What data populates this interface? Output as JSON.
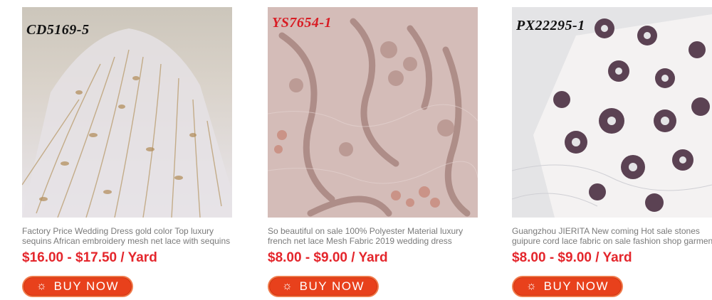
{
  "products": [
    {
      "code": "CD5169-5",
      "description_line1": "Factory Price Wedding Dress gold color Top luxury",
      "description_line2": "sequins African embroidery mesh net lace with sequins",
      "price": "$16.00 - $17.50 / Yard",
      "button_label": "BUY NOW",
      "button_icon": "sun-icon"
    },
    {
      "code": "YS7654-1",
      "description_line1": "So beautiful on sale 100% Polyester Material luxury",
      "description_line2": "french net lace Mesh Fabric 2019 wedding dress",
      "price": "$8.00 - $9.00 / Yard",
      "button_label": "BUY NOW",
      "button_icon": "sun-icon"
    },
    {
      "code": "PX22295-1",
      "description_line1": "Guangzhou JIERITA New coming Hot sale stones",
      "description_line2": "guipure cord lace fabric on sale fashion shop garment",
      "price": "$8.00 - $9.00 / Yard",
      "button_label": "BUY NOW",
      "button_icon": "sun-icon"
    }
  ],
  "colors": {
    "price": "#e4262c",
    "button_bg": "#e8411c",
    "description": "#7a7a7a"
  }
}
